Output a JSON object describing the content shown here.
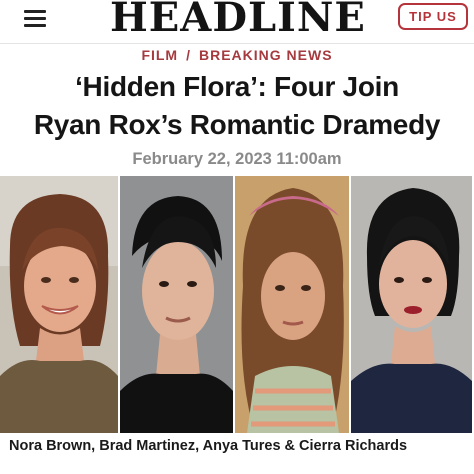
{
  "header": {
    "menu_icon": "hamburger-menu-icon",
    "logo_text": "HEADLINE",
    "tip_button_label": "TIP US"
  },
  "breadcrumb": {
    "section": "FILM",
    "separator": "/",
    "subsection": "BREAKING NEWS"
  },
  "article": {
    "title_line1": "‘Hidden Flora’: Four Join",
    "title_line2": "Ryan Rox’s Romantic Dramedy",
    "date": "February 22, 2023 11:00am",
    "image_caption": "Nora Brown, Brad Martinez, Anya Tures & Cierra Richards"
  },
  "colors": {
    "accent": "#b5343b",
    "breadcrumb": "#a53a3f",
    "date_gray": "#8a8a8a",
    "text": "#151515"
  }
}
